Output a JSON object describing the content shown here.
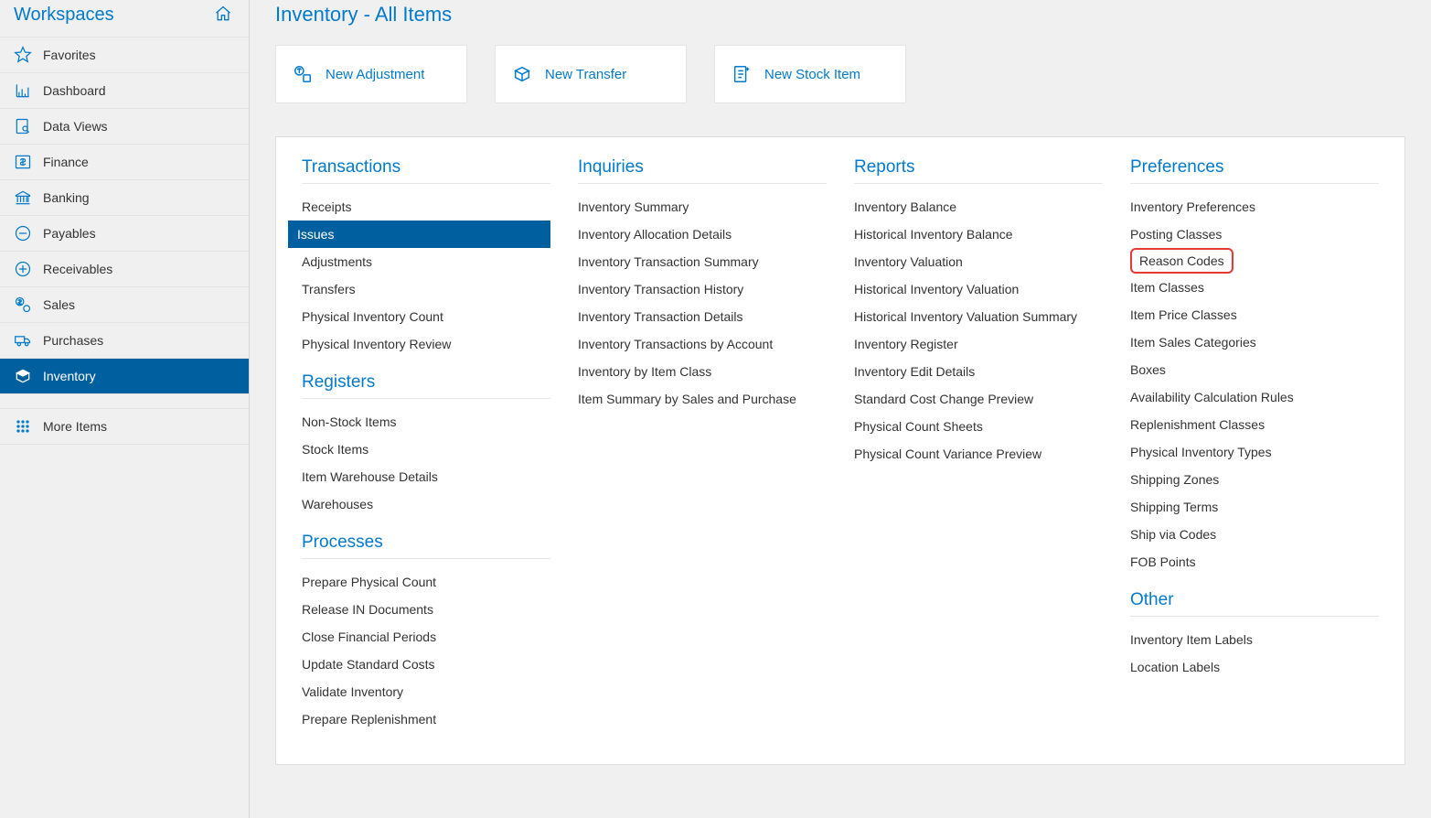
{
  "sidebar": {
    "title": "Workspaces",
    "items": [
      {
        "label": "Favorites"
      },
      {
        "label": "Dashboard"
      },
      {
        "label": "Data Views"
      },
      {
        "label": "Finance"
      },
      {
        "label": "Banking"
      },
      {
        "label": "Payables"
      },
      {
        "label": "Receivables"
      },
      {
        "label": "Sales"
      },
      {
        "label": "Purchases"
      },
      {
        "label": "Inventory"
      }
    ],
    "more": "More Items"
  },
  "page": {
    "title": "Inventory - All Items"
  },
  "actions": {
    "adjust": "New Adjustment",
    "transfer": "New Transfer",
    "stock": "New Stock Item"
  },
  "columns": {
    "transactions_title": "Transactions",
    "transactions": [
      "Receipts",
      "Issues",
      "Adjustments",
      "Transfers",
      "Physical Inventory Count",
      "Physical Inventory Review"
    ],
    "registers_title": "Registers",
    "registers": [
      "Non-Stock Items",
      "Stock Items",
      "Item Warehouse Details",
      "Warehouses"
    ],
    "processes_title": "Processes",
    "processes": [
      "Prepare Physical Count",
      "Release IN Documents",
      "Close Financial Periods",
      "Update Standard Costs",
      "Validate Inventory",
      "Prepare Replenishment"
    ],
    "inquiries_title": "Inquiries",
    "inquiries": [
      "Inventory Summary",
      "Inventory Allocation Details",
      "Inventory Transaction Summary",
      "Inventory Transaction History",
      "Inventory Transaction Details",
      "Inventory Transactions by Account",
      "Inventory by Item Class",
      "Item Summary by Sales and Purchase"
    ],
    "reports_title": "Reports",
    "reports": [
      "Inventory Balance",
      "Historical Inventory Balance",
      "Inventory Valuation",
      "Historical Inventory Valuation",
      "Historical Inventory Valuation Summary",
      "Inventory Register",
      "Inventory Edit Details",
      "Standard Cost Change Preview",
      "Physical Count Sheets",
      "Physical Count Variance Preview"
    ],
    "preferences_title": "Preferences",
    "preferences": [
      "Inventory Preferences",
      "Posting Classes",
      "Reason Codes",
      "Item Classes",
      "Item Price Classes",
      "Item Sales Categories",
      "Boxes",
      "Availability Calculation Rules",
      "Replenishment Classes",
      "Physical Inventory Types",
      "Shipping Zones",
      "Shipping Terms",
      "Ship via Codes",
      "FOB Points"
    ],
    "other_title": "Other",
    "other": [
      "Inventory Item Labels",
      "Location Labels"
    ]
  }
}
